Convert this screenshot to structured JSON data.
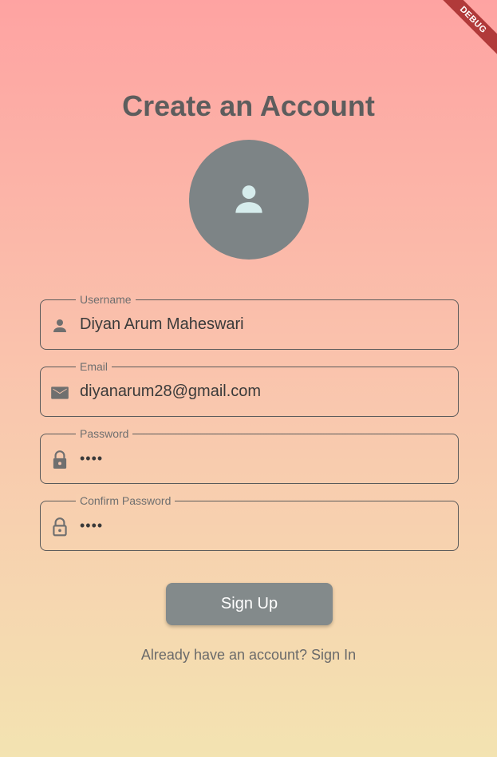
{
  "debug_banner": "DEBUG",
  "title": "Create an Account",
  "avatar": {
    "icon": "person-icon"
  },
  "form": {
    "username": {
      "label": "Username",
      "value": "Diyan Arum Maheswari",
      "icon": "person-icon"
    },
    "email": {
      "label": "Email",
      "value": "diyanarum28@gmail.com",
      "icon": "mail-icon"
    },
    "password": {
      "label": "Password",
      "value": "••••",
      "icon": "lock-icon"
    },
    "confirm_password": {
      "label": "Confirm Password",
      "value": "••••",
      "icon": "lock-open-outline-icon"
    }
  },
  "signup_button": "Sign Up",
  "signin_link": "Already have an account? Sign In",
  "colors": {
    "gradient_top": "#fea3a2",
    "gradient_bottom": "#f3e3b1",
    "avatar_bg": "#7d8486",
    "button_bg": "#838a8b",
    "debug_banner": "#b13a3a"
  }
}
